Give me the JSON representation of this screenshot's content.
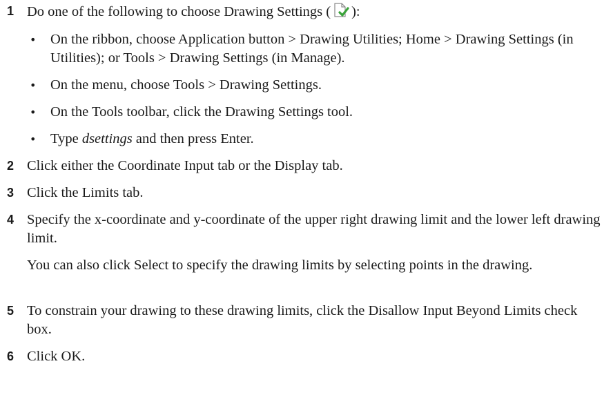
{
  "steps": [
    {
      "number": "1",
      "text_before_icon": "Do one of the following to choose Drawing Settings (",
      "text_after_icon": "):",
      "icon": "drawing-settings-icon",
      "bullets": [
        {
          "text": "On the ribbon, choose Application button > Drawing Utilities; Home > Drawing Settings (in Utilities); or Tools > Drawing Settings (in Manage)."
        },
        {
          "text": "On the menu, choose Tools > Drawing Settings."
        },
        {
          "text": "On the Tools toolbar, click the Drawing Settings tool."
        },
        {
          "text_before": "Type ",
          "emphasis": "dsettings",
          "text_after": " and then press Enter."
        }
      ]
    },
    {
      "number": "2",
      "text": "Click either the Coordinate Input tab or the Display tab."
    },
    {
      "number": "3",
      "text": "Click the Limits tab."
    },
    {
      "number": "4",
      "text": "Specify the x-coordinate and y-coordinate of the upper right drawing limit and the lower left drawing limit.",
      "note": "You can also click Select to specify the drawing limits by selecting points in the drawing."
    },
    {
      "number": "5",
      "text": "To constrain your drawing to these drawing limits, click the Disallow Input Beyond Limits check box."
    },
    {
      "number": "6",
      "text": "Click OK."
    }
  ],
  "colors": {
    "icon_check": "#3aa33a",
    "icon_page": "#8a8a8a"
  }
}
